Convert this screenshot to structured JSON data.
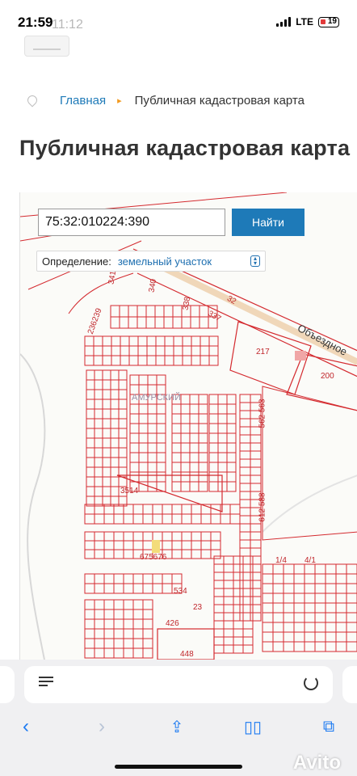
{
  "status_bar": {
    "time": "21:59",
    "ghost_time": "11:12",
    "network": "LTE",
    "battery_level": "19"
  },
  "breadcrumb": {
    "home": "Главная",
    "separator": "▸",
    "current": "Публичная кадастровая карта"
  },
  "page": {
    "title": "Публичная кадастровая карта"
  },
  "map": {
    "search": {
      "value": "75:32:010224:390",
      "button": "Найти"
    },
    "definition": {
      "label": "Определение:",
      "selected": "земельный участок"
    },
    "labels": [
      "341",
      "340",
      "338",
      "337",
      "32",
      "236239",
      "217",
      "200",
      "3514",
      "675676",
      "534",
      "426",
      "448",
      "23",
      "562 563",
      "612 588",
      "1/4",
      "4/1"
    ],
    "road_label": "Объездное",
    "district_label": "АМУРСКИЙ",
    "parcel_color": "#d42a2f"
  },
  "browser": {
    "accent": "#1e7bf2"
  },
  "watermark": "Avito"
}
